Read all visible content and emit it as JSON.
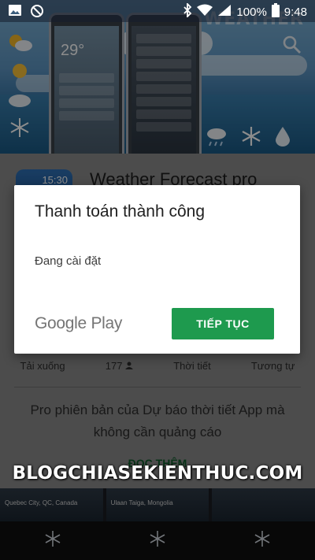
{
  "status_bar": {
    "battery_percent": "100%",
    "time": "9:48",
    "icons": [
      "image-icon",
      "blocked-icon",
      "bluetooth-icon",
      "wifi-icon",
      "signal-icon",
      "battery-icon"
    ]
  },
  "banner": {
    "title_word": "WEATHER",
    "phone1_temp": "29°",
    "icons": [
      "search-icon",
      "sun-cloud-icon",
      "snowflake-icon",
      "rain-icon"
    ]
  },
  "app": {
    "icon_time": "15:30",
    "title": "Weather Forecast pro",
    "stats": {
      "downloads_label": "Tải xuống",
      "rating_count": "177",
      "category": "Thời tiết",
      "similar": "Tương tự"
    },
    "description": "Pro phiên bản của Dự báo thời tiết App mà không cần quảng cáo",
    "read_more": "ĐỌC THÊM"
  },
  "screenshots": {
    "labels": [
      "Quebec City, QC, Canada",
      "Ulaan Taiga, Mongolia",
      ""
    ]
  },
  "dialog": {
    "title": "Thanh toán thành công",
    "message": "Đang cài đặt",
    "brand": "Google Play",
    "continue_label": "TIẾP TỤC"
  },
  "watermark": "BLOGCHIASEKIENTHUC.COM",
  "colors": {
    "accent_green": "#1e9a4e",
    "scrim": "rgba(0,0,0,0.45)"
  }
}
